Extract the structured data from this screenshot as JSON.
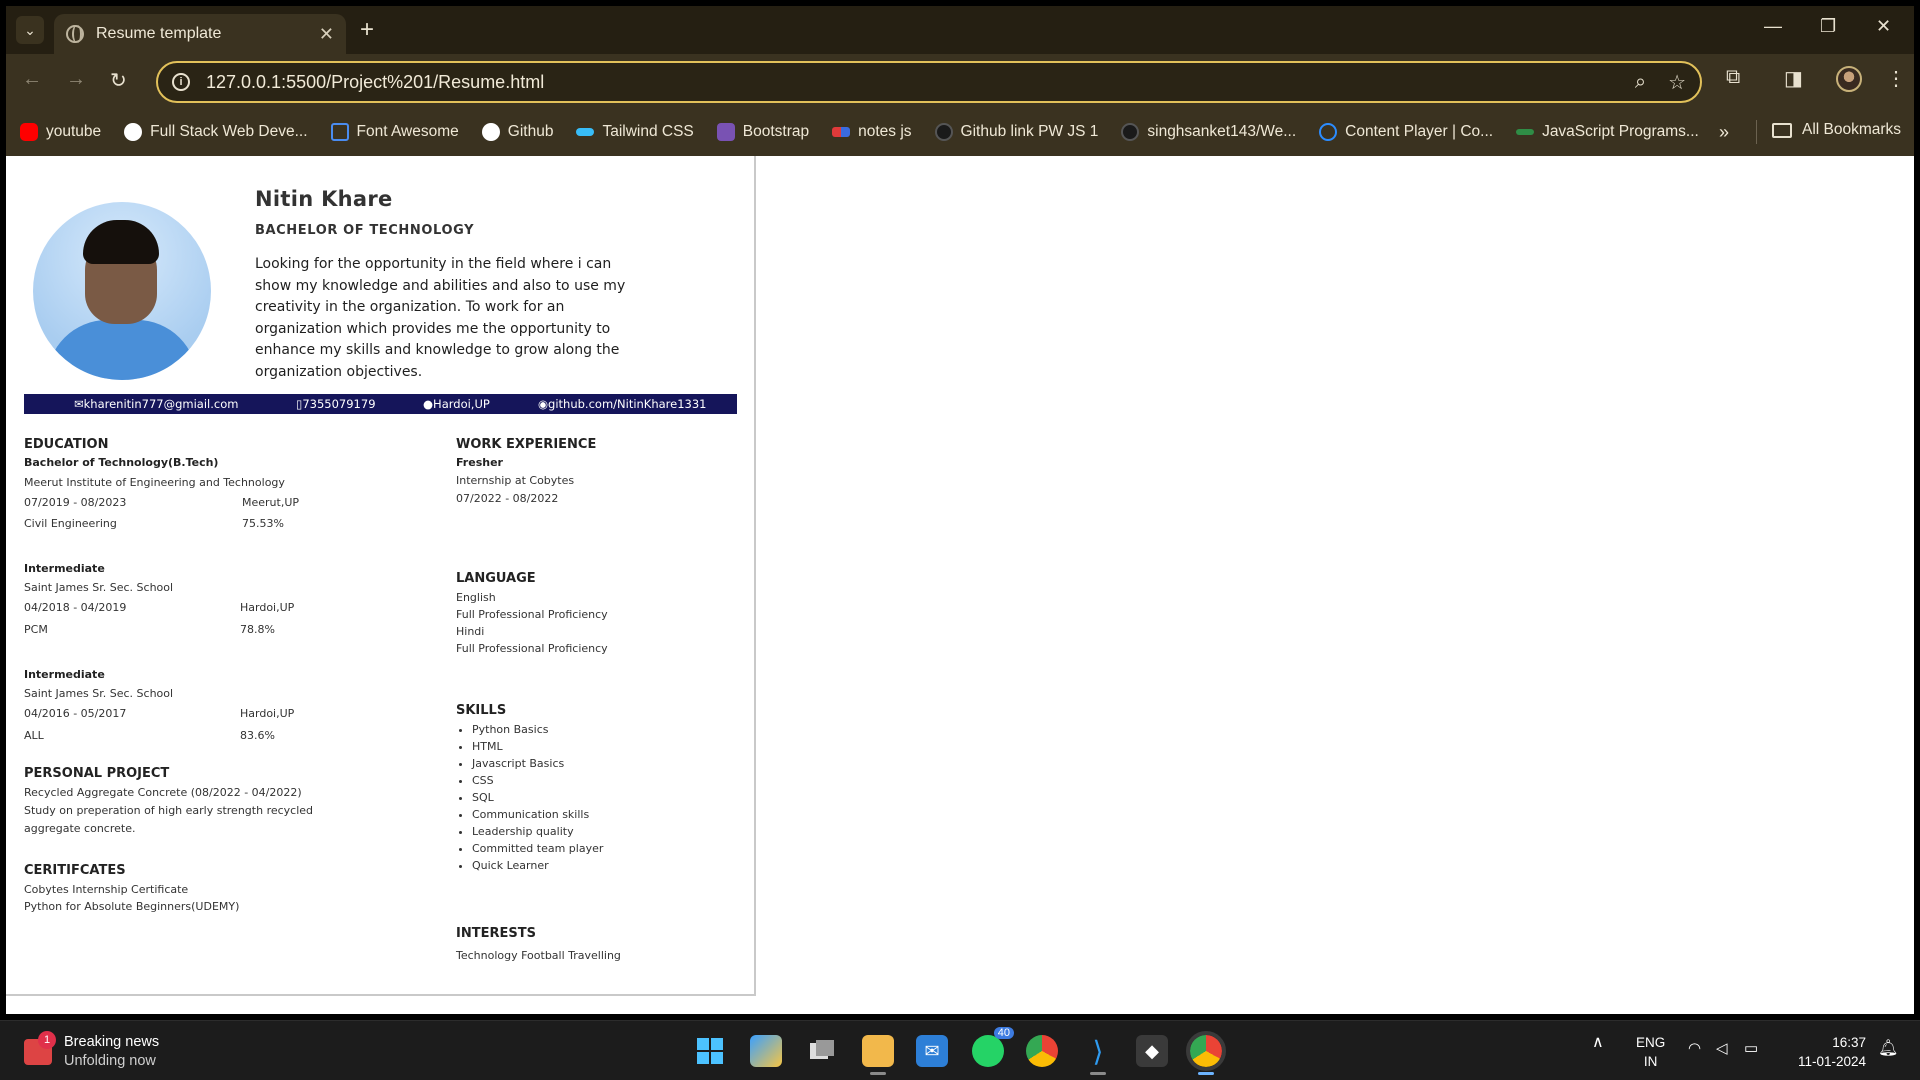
{
  "browser": {
    "tab_title": "Resume template",
    "url": "127.0.0.1:5500/Project%201/Resume.html",
    "bookmarks": [
      {
        "label": "youtube",
        "icon": "youtube-icon",
        "color": "#ff0000"
      },
      {
        "label": "Full Stack Web Deve...",
        "icon": "wordpress-icon",
        "color": "#ffffff"
      },
      {
        "label": "Font Awesome",
        "icon": "flag-icon",
        "color": "#4a8cf0"
      },
      {
        "label": "Github",
        "icon": "github-icon",
        "color": "#ffffff"
      },
      {
        "label": "Tailwind CSS",
        "icon": "tailwind-icon",
        "color": "#38bdf8"
      },
      {
        "label": "Bootstrap",
        "icon": "bootstrap-icon",
        "color": "#7952b3"
      },
      {
        "label": "notes js",
        "icon": "notes-icon",
        "color": "#e03a3a"
      },
      {
        "label": "Github link PW JS 1",
        "icon": "github-icon",
        "color": "#ffffff"
      },
      {
        "label": "singhsanket143/We...",
        "icon": "github-icon",
        "color": "#ffffff"
      },
      {
        "label": "Content Player | Co...",
        "icon": "power-icon",
        "color": "#2b8cff"
      },
      {
        "label": "JavaScript Programs...",
        "icon": "gfg-icon",
        "color": "#2f8d46"
      }
    ],
    "all_bookmarks": "All Bookmarks"
  },
  "resume": {
    "name": "Nitin Khare",
    "degree": "BACHELOR  OF  TECHNOLOGY",
    "objective": "Looking for the opportunity in the field where i can show my knowledge and abilities and also to use my creativity in the organization. To work for an organization which provides me the opportunity to enhance my skills and knowledge to grow along the organization objectives.",
    "contact": {
      "email": "kharenitin777@gmiail.com",
      "phone": "7355079179",
      "location": "Hardoi,UP",
      "github": "github.com/NitinKhare1331"
    },
    "education": {
      "title": "EDUCATION",
      "entries": [
        {
          "heading": "Bachelor of Technology(B.Tech)",
          "school": "Meerut Institute of Engineering and Technology",
          "dates": "07/2019 - 08/2023",
          "place": "Meerut,UP",
          "field": "Civil Engineering",
          "score": "75.53%"
        },
        {
          "heading": "Intermediate",
          "school": "Saint James Sr. Sec. School",
          "dates": "04/2018 - 04/2019",
          "place": "Hardoi,UP",
          "field": "PCM",
          "score": "78.8%"
        },
        {
          "heading": "Intermediate",
          "school": "Saint James Sr. Sec. School",
          "dates": "04/2016 - 05/2017",
          "place": "Hardoi,UP",
          "field": "ALL",
          "score": "83.6%"
        }
      ]
    },
    "project": {
      "title": "PERSONAL PROJECT",
      "line1": "Recycled Aggregate Concrete (08/2022 - 04/2022)",
      "line2": "Study on preperation of high early strength recycled",
      "line3": "aggregate concrete."
    },
    "certificates": {
      "title": "CERITIFCATES",
      "items": [
        "Cobytes Internship Certificate",
        "Python for Absolute Beginners(UDEMY)"
      ]
    },
    "work": {
      "title": "WORK EXPERIENCE",
      "role": "Fresher",
      "company": "Internship at Cobytes",
      "dates": "07/2022 - 08/2022"
    },
    "language": {
      "title": "LANGUAGE",
      "items": [
        "English",
        "Full Professional Proficiency",
        "Hindi",
        "Full Professional Proficiency"
      ]
    },
    "skills": {
      "title": "SKILLS",
      "items": [
        "Python Basics",
        "HTML",
        "Javascript Basics",
        "CSS",
        "SQL",
        "Communication skills",
        "Leadership quality",
        "Committed team player",
        "Quick Learner"
      ]
    },
    "interests": {
      "title": "INTERESTS",
      "text": "Technology Football Travelling"
    }
  },
  "taskbar": {
    "news_badge": "1",
    "news_title": "Breaking news",
    "news_sub": "Unfolding now",
    "whatsapp_badge": "40",
    "lang_top": "ENG",
    "lang_bottom": "IN",
    "time": "16:37",
    "date": "11-01-2024"
  }
}
